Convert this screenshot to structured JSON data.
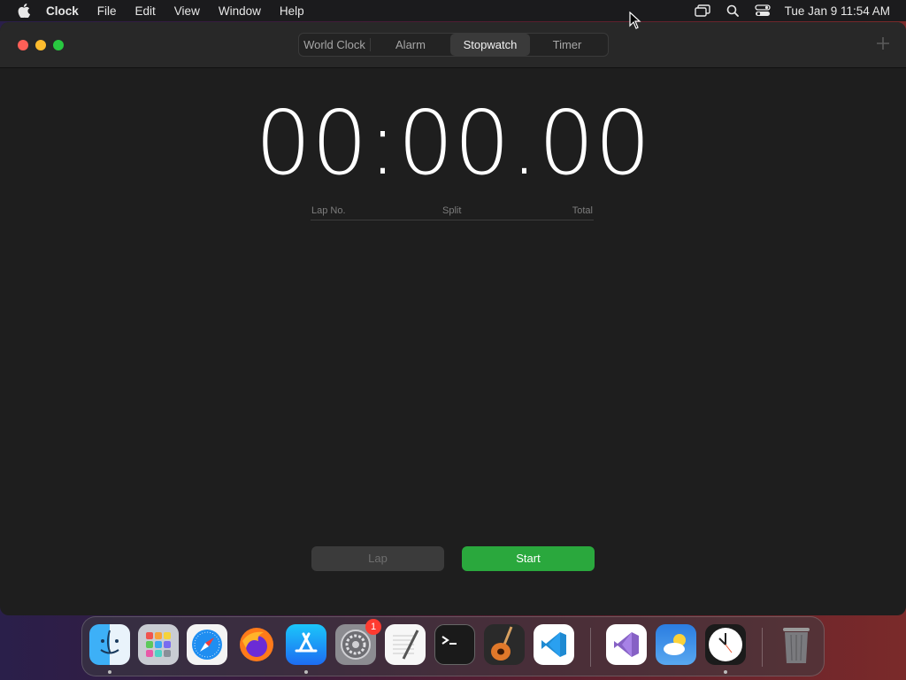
{
  "menubar": {
    "apple_icon": "apple-logo-icon",
    "app_name": "Clock",
    "items": [
      "File",
      "Edit",
      "View",
      "Window",
      "Help"
    ],
    "status_icons": [
      "screen-mirroring-icon",
      "spotlight-search-icon",
      "control-center-icon"
    ],
    "datetime": "Tue Jan 9  11:54 AM"
  },
  "window": {
    "tabs": [
      {
        "label": "World Clock",
        "active": false
      },
      {
        "label": "Alarm",
        "active": false
      },
      {
        "label": "Stopwatch",
        "active": true
      },
      {
        "label": "Timer",
        "active": false
      }
    ],
    "add_icon": "plus-icon",
    "stopwatch": {
      "time": "00:00.00",
      "laps_columns": [
        "Lap No.",
        "Split",
        "Total"
      ],
      "lap_button": "Lap",
      "start_button": "Start"
    }
  },
  "dock": {
    "apps": [
      {
        "name": "Finder",
        "icon": "finder-icon",
        "running": true
      },
      {
        "name": "Launchpad",
        "icon": "launchpad-icon",
        "running": false
      },
      {
        "name": "Safari",
        "icon": "safari-icon",
        "running": false
      },
      {
        "name": "Firefox",
        "icon": "firefox-icon",
        "running": false
      },
      {
        "name": "App Store",
        "icon": "app-store-icon",
        "running": true
      },
      {
        "name": "System Settings",
        "icon": "system-settings-icon",
        "running": false,
        "badge": "1"
      },
      {
        "name": "TextEdit",
        "icon": "textedit-icon",
        "running": false
      },
      {
        "name": "Terminal",
        "icon": "terminal-icon",
        "running": false
      },
      {
        "name": "GarageBand",
        "icon": "garageband-icon",
        "running": false
      },
      {
        "name": "Visual Studio Code",
        "icon": "vscode-icon",
        "running": false
      },
      {
        "name": "Visual Studio",
        "icon": "visual-studio-icon",
        "running": false
      },
      {
        "name": "Weather",
        "icon": "weather-icon",
        "running": false
      },
      {
        "name": "Clock",
        "icon": "clock-icon",
        "running": true
      },
      {
        "name": "Trash",
        "icon": "trash-icon",
        "running": false
      }
    ]
  }
}
